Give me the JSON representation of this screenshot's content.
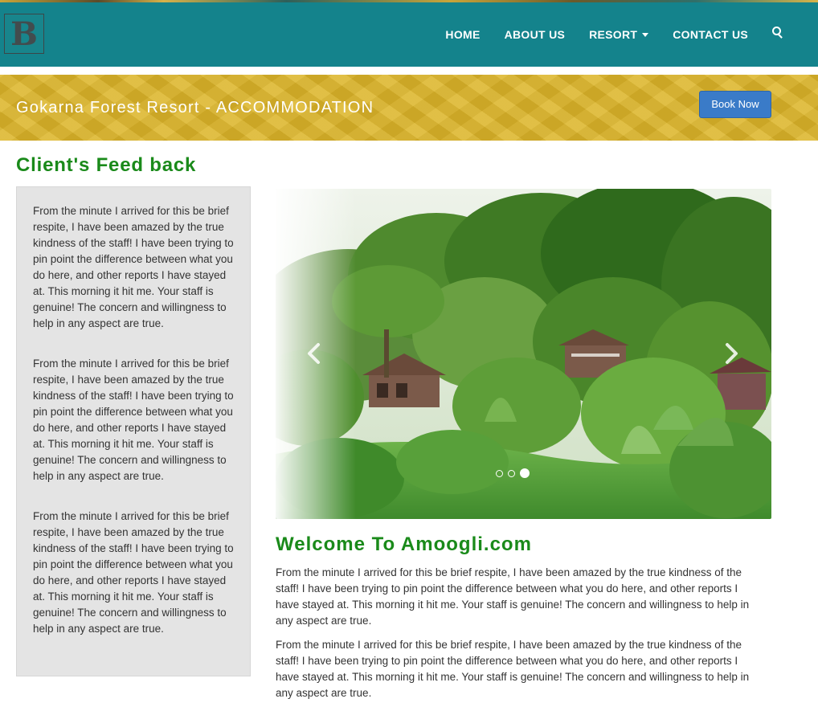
{
  "brand": {
    "logo_letter": "B"
  },
  "nav": {
    "items": [
      {
        "label": "HOME"
      },
      {
        "label": "ABOUT US"
      },
      {
        "label": "RESORT",
        "has_dropdown": true
      },
      {
        "label": "CONTACT US"
      }
    ],
    "search_icon": "search-icon"
  },
  "banner": {
    "title": "Gokarna Forest Resort - ACCOMMODATION",
    "book_button": "Book Now"
  },
  "feedback": {
    "heading": "Client's Feed back",
    "testimonials": [
      "From the minute I arrived for this be brief respite, I have been amazed by the true kindness of the staff! I have been trying to pin point the difference between what you do here, and other reports I have stayed at. This morning it hit me. Your staff is genuine! The concern and willingness to help in any aspect are true.",
      "From the minute I arrived for this be brief respite, I have been amazed by the true kindness of the staff! I have been trying to pin point the difference between what you do here, and other reports I have stayed at. This morning it hit me. Your staff is genuine! The concern and willingness to help in any aspect are true.",
      "From the minute I arrived for this be brief respite, I have been amazed by the true kindness of the staff! I have been trying to pin point the difference between what you do here, and other reports I have stayed at. This morning it hit me. Your staff is genuine! The concern and willingness to help in any aspect are true."
    ]
  },
  "carousel": {
    "slide_count": 3,
    "active_index": 2,
    "prev_icon": "chevron-left-icon",
    "next_icon": "chevron-right-icon"
  },
  "welcome": {
    "heading": "Welcome To Amoogli.com",
    "paragraphs": [
      "From the minute I arrived for this be brief respite, I have been amazed by the true kindness of the staff! I have been trying to pin point the difference between what you do here, and other reports I have stayed at. This morning it hit me. Your staff is genuine! The concern and willingness to help in any aspect are true.",
      "From the minute I arrived for this be brief respite, I have been amazed by the true kindness of the staff! I have been trying to pin point the difference between what you do here, and other reports I have stayed at. This morning it hit me. Your staff is genuine! The concern and willingness to help in any aspect are true."
    ]
  },
  "colors": {
    "navbar": "#14838c",
    "banner": "#d5b02a",
    "heading_green": "#1a8a1a",
    "book_button": "#3a7bc8",
    "feedback_bg": "#e4e4e4"
  }
}
